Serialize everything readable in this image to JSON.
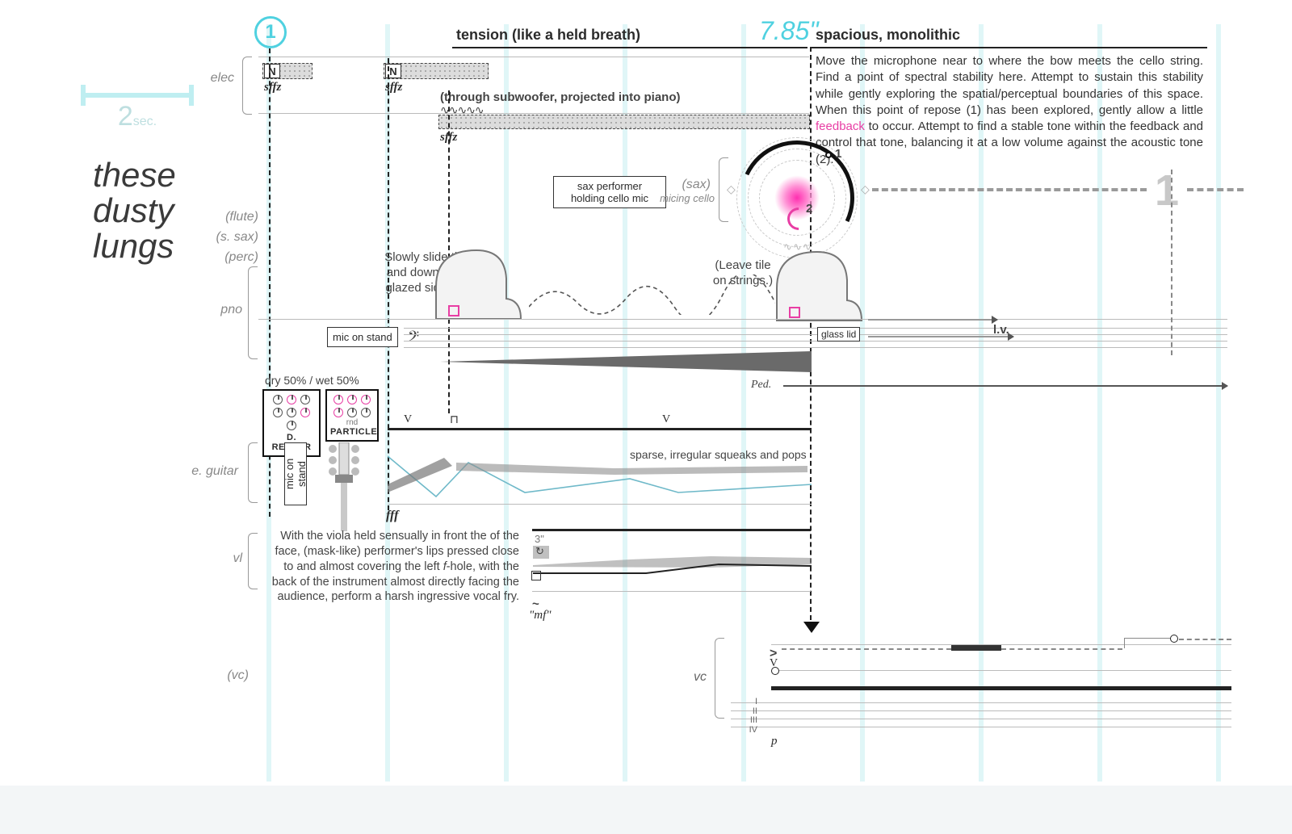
{
  "title_lines": [
    "these",
    "dusty",
    "lungs"
  ],
  "ruler": {
    "value": "2",
    "unit": "sec."
  },
  "rehearsal_mark": "1",
  "top": {
    "expr_left": "tension (like a held breath)",
    "timecode": "7.85\"",
    "expr_right": "spacious, monolithic"
  },
  "paragraph": "Move the microphone near to where the bow meets the cello string. Find a point of spectral stability here. Attempt to sustain this stability while gently exploring the spatial/perceptual boundaries of this space. When this point of repose (1) has been explored, gently allow a little feedback to occur. Attempt to find a stable tone within the feedback and control that tone, balancing it at a low volume against the acoustic tone (2).",
  "paragraph_highlight_word": "feedback",
  "instruments": {
    "elec": "elec",
    "flute": "(flute)",
    "ssax": "(s. sax)",
    "perc": "(perc)",
    "pno": "pno",
    "eguitar": "e. guitar",
    "vl": "vl",
    "vc": "(vc)",
    "sax_paren": "(sax)",
    "sax_note": "micing cello",
    "vc_right": "vc"
  },
  "elec": {
    "n_label": "N",
    "sffz": "sffz",
    "sub_note": "(through subwoofer, projected into piano)",
    "wave_glyph": "∿∿∿∿∿"
  },
  "sax_box": "sax performer\nholding cello mic",
  "orb": {
    "label1": "1",
    "label2": "2"
  },
  "pno": {
    "tile_note": "Slowly slide tile up\nand down strings,\nglazed side down.",
    "leave_note": "(Leave tile\non strings.)",
    "mic_label": "mic on stand",
    "glass_lid": "glass lid",
    "lv": "l.v.",
    "ped": "Ped.",
    "sffz": "sffz"
  },
  "pedals": {
    "mix": "dry 50% / wet 50%",
    "dreaper": "D. REAPER",
    "particle": "PARTICLE",
    "rnd": "rnd"
  },
  "eguitar": {
    "mic_label": "mic on stand",
    "fff": "fff",
    "sparse": "sparse, irregular squeaks and pops",
    "bow_v": "V"
  },
  "vl": {
    "instruction": "With the viola held sensually in front the of the face, (mask-like) performer's lips pressed close to and almost covering the left f-hole, with the back of the instrument almost directly facing the audience, perform a harsh ingressive vocal fry.",
    "time": "3\"",
    "mf": "\"mf\"",
    "tilde": "~"
  },
  "vc_right": {
    "romans": [
      "I",
      "II",
      "III",
      "IV"
    ],
    "p": "p",
    "accent": ">",
    "bow_v": "V"
  },
  "ghost_label": "1"
}
